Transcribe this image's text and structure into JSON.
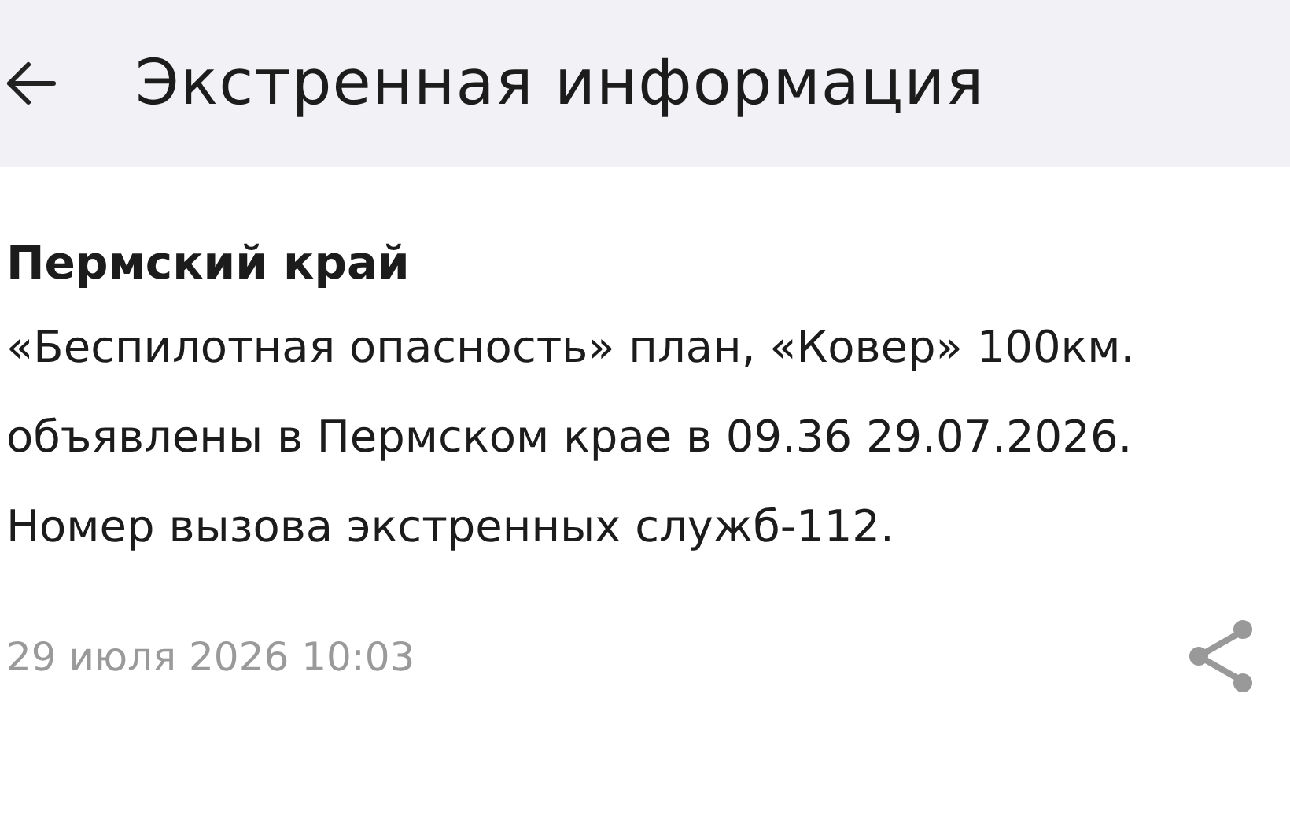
{
  "header": {
    "title": "Экстренная информация"
  },
  "alert": {
    "region": "Пермский край",
    "message": "«Беспилотная опасность» план, «Ковер» 100км. объявлены в Пермском крае в 09.36 29.07.2026. Номер вызова экстренных служб-112.",
    "timestamp": "29 июля 2026 10:03"
  }
}
